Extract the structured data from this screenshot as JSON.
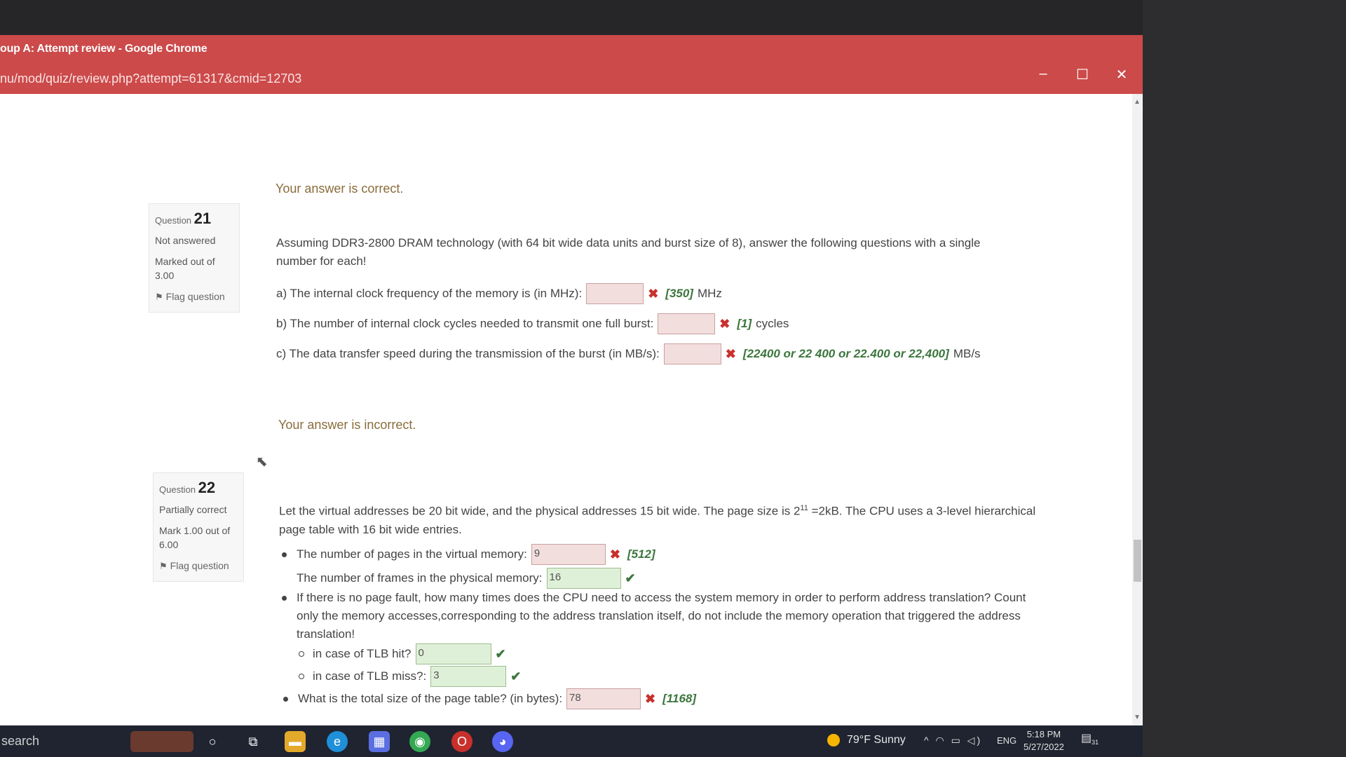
{
  "window": {
    "title": "oup A: Attempt review - Google Chrome",
    "url": "nu/mod/quiz/review.php?attempt=61317&cmid=12703",
    "controls": {
      "minimize": "–",
      "maximize": "☐",
      "close": "✕"
    }
  },
  "prev_feedback": "Your answer is correct.",
  "q21": {
    "label": "Question",
    "number": "21",
    "state": "Not answered",
    "grade": "Marked out of 3.00",
    "flag": "Flag question",
    "text": "Assuming DDR3-2800 DRAM technology (with 64 bit wide data units and burst size of 8), answer the following questions with a single number for each!",
    "parts": [
      {
        "prompt": "a) The internal clock frequency of the memory is (in MHz):",
        "value": "",
        "correct": "[350]",
        "unit": "MHz"
      },
      {
        "prompt": "b) The number of internal clock cycles needed to transmit one full burst:",
        "value": "",
        "correct": "[1]",
        "unit": "cycles"
      },
      {
        "prompt": "c) The data transfer speed during the transmission of the burst (in MB/s):",
        "value": "",
        "correct": "[22400 or 22 400 or 22.400 or 22,400]",
        "unit": "MB/s"
      }
    ],
    "feedback": "Your answer is incorrect."
  },
  "q22": {
    "label": "Question",
    "number": "22",
    "state": "Partially correct",
    "grade": "Mark 1.00 out of 6.00",
    "flag": "Flag question",
    "text_a": "Let the virtual addresses be 20 bit wide, and the physical addresses 15 bit wide. The page size is 2",
    "text_sup": "11",
    "text_b": " =2kB. The CPU uses a 3-level hierarchical page table with 16 bit wide entries.",
    "pages_prompt": "The number of pages in the virtual memory:",
    "pages_value": "9",
    "pages_correct": "[512]",
    "frames_prompt": "The number of frames in the physical memory:",
    "frames_value": "16",
    "access_text": "If there is no page fault, how many times does the CPU need to access the system memory in order to perform address translation? Count only the memory accesses,corresponding to the address translation itself, do not include the memory operation that triggered the address translation!",
    "tlb_hit_prompt": "in case of TLB hit?",
    "tlb_hit_value": "0",
    "tlb_miss_prompt": "in case of TLB miss?:",
    "tlb_miss_value": "3",
    "size_prompt": "What is the total size of the page table? (in bytes):",
    "size_value": "78",
    "size_correct": "[1168]"
  },
  "taskbar": {
    "search": "search",
    "weather": "79°F  Sunny",
    "lang": "ENG",
    "time": "5:18 PM",
    "date": "5/27/2022",
    "notif_count": "31"
  }
}
